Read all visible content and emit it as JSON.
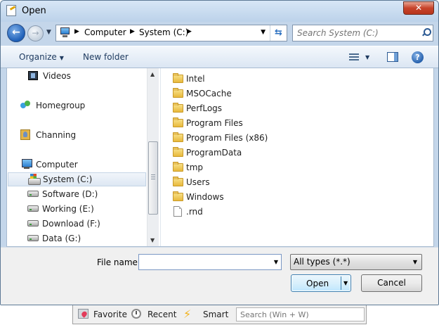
{
  "window": {
    "title": "Open",
    "close_glyph": "✕"
  },
  "nav": {
    "back_glyph": "←",
    "forward_glyph": "→",
    "history_glyph": "▼",
    "breadcrumbs": [
      "Computer",
      "System (C:)"
    ],
    "crumb_sep": "▶",
    "address_drop": "▼",
    "refresh_glyph": "⇆",
    "search_placeholder": "Search System (C:)"
  },
  "toolbar": {
    "organize_label": "Organize",
    "organize_caret": "▼",
    "new_folder_label": "New folder",
    "views_caret": "▼",
    "help_glyph": "?"
  },
  "navpane": {
    "items": [
      {
        "label": "Videos",
        "icon": "film-icon"
      },
      {
        "label": "Homegroup",
        "icon": "homegroup-icon"
      },
      {
        "label": "Channing",
        "icon": "user-folder-icon"
      },
      {
        "label": "Computer",
        "icon": "computer-icon"
      },
      {
        "label": "System (C:)",
        "icon": "system-drive-icon",
        "selected": true
      },
      {
        "label": "Software (D:)",
        "icon": "drive-icon"
      },
      {
        "label": "Working (E:)",
        "icon": "drive-icon"
      },
      {
        "label": "Download (F:)",
        "icon": "drive-icon"
      },
      {
        "label": "Data (G:)",
        "icon": "drive-icon"
      }
    ],
    "scroll_up": "▲",
    "scroll_down": "▼"
  },
  "files": [
    {
      "name": "Intel",
      "type": "folder"
    },
    {
      "name": "MSOCache",
      "type": "folder"
    },
    {
      "name": "PerfLogs",
      "type": "folder"
    },
    {
      "name": "Program Files",
      "type": "folder"
    },
    {
      "name": "Program Files (x86)",
      "type": "folder"
    },
    {
      "name": "ProgramData",
      "type": "folder"
    },
    {
      "name": "tmp",
      "type": "folder"
    },
    {
      "name": "Users",
      "type": "folder"
    },
    {
      "name": "Windows",
      "type": "folder"
    },
    {
      "name": ".rnd",
      "type": "file"
    }
  ],
  "bottom": {
    "file_name_label": "File name:",
    "file_name_value": "",
    "file_name_caret": "▼",
    "file_type_value": "All types (*.*)",
    "file_type_caret": "▼",
    "open_label": "Open",
    "open_caret": "▼",
    "cancel_label": "Cancel"
  },
  "aux_bar": {
    "favorite_label": "Favorite",
    "recent_label": "Recent",
    "smart_label": "Smart",
    "smart_glyph": "⚡",
    "search_placeholder": "Search (Win + W)"
  }
}
